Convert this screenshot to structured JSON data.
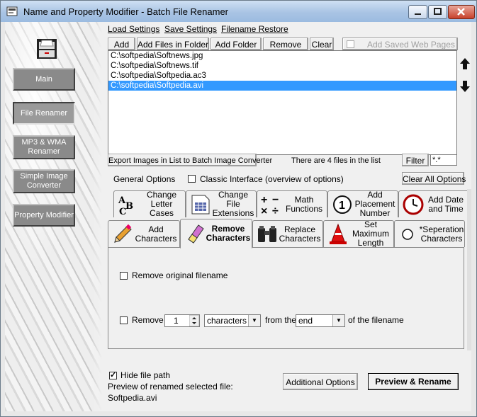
{
  "window": {
    "title": "Name and Property Modifier - Batch File Renamer"
  },
  "sidebar": {
    "items": [
      {
        "label": "Main"
      },
      {
        "label": "File Renamer"
      },
      {
        "label": "MP3 & WMA Renamer"
      },
      {
        "label": "Simple Image Converter"
      },
      {
        "label": "Property Modifier"
      }
    ]
  },
  "menu": {
    "load": "Load Settings",
    "save": "Save Settings",
    "restore": "Filename Restore"
  },
  "toolbar": {
    "add": "Add",
    "add_files": "Add Files in Folder",
    "add_folder": "Add Folder",
    "remove": "Remove",
    "clear": "Clear",
    "add_saved_web": "Add Saved Web Pages"
  },
  "files": [
    "C:\\softpedia\\Softnews.jpg",
    "C:\\softpedia\\Softnews.tif",
    "C:\\softpedia\\Softpedia.ac3",
    "C:\\softpedia\\Softpedia.avi"
  ],
  "selected_file_index": 3,
  "list_footer": {
    "export": "Export Images in List to Batch Image Converter",
    "count_text": "There are 4 files in the list",
    "filter_label": "Filter",
    "filter_value": "*.*"
  },
  "options": {
    "general": "General Options",
    "classic": "Classic Interface (overview of options)",
    "clear_all": "Clear All Options"
  },
  "tabs_top": [
    {
      "label": "Change Letter Cases",
      "icon": "abc-letters-icon"
    },
    {
      "label": "Change File Extensions",
      "icon": "file-grid-icon"
    },
    {
      "label": "Math Functions",
      "icon": "math-symbols-icon"
    },
    {
      "label": "Add Placement Number",
      "icon": "number-one-icon"
    },
    {
      "label": "Add Date and Time",
      "icon": "clock-icon"
    }
  ],
  "tabs_bottom": [
    {
      "label": "Add Characters",
      "icon": "pencil-icon"
    },
    {
      "label": "Remove Characters",
      "icon": "eraser-icon"
    },
    {
      "label": "Replace Characters",
      "icon": "binoculars-icon"
    },
    {
      "label": "Set Maximum Length",
      "icon": "cone-icon"
    },
    {
      "label": "*Seperation Characters",
      "icon": "circle-icon"
    }
  ],
  "panel": {
    "remove_original": "Remove original filename",
    "remove": "Remove",
    "count": "1",
    "unit": "characters",
    "from_the": "from the",
    "position": "end",
    "of_filename": "of the filename"
  },
  "bottom": {
    "hide_path": "Hide file path",
    "preview_label": "Preview of renamed selected file:",
    "preview_value": "Softpedia.avi",
    "additional": "Additional Options",
    "preview_rename": "Preview & Rename"
  },
  "colors": {
    "selection": "#3399ff",
    "sidebar_button": "#8a8a8a"
  }
}
